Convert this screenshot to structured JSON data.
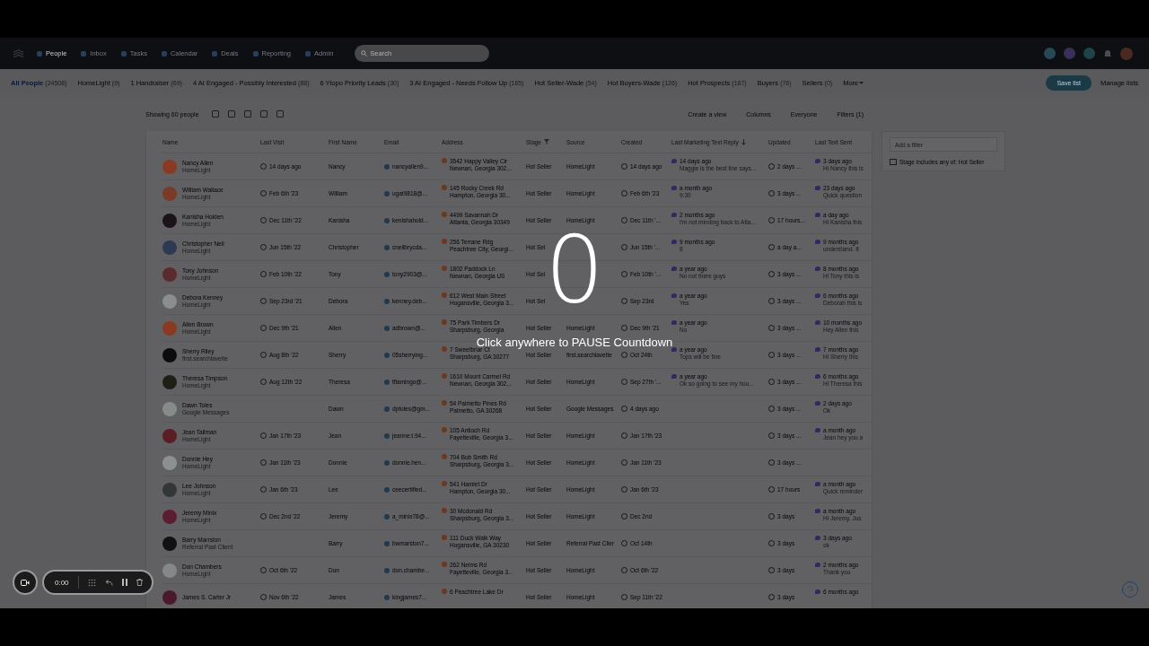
{
  "nav": {
    "items": [
      {
        "label": "People",
        "selected": true
      },
      {
        "label": "Inbox",
        "selected": false
      },
      {
        "label": "Tasks",
        "selected": false
      },
      {
        "label": "Calendar",
        "selected": false
      },
      {
        "label": "Deals",
        "selected": false
      },
      {
        "label": "Reporting",
        "selected": false
      },
      {
        "label": "Admin",
        "selected": false
      }
    ],
    "search": {
      "placeholder": "Search"
    }
  },
  "lists": {
    "tabs": [
      {
        "label": "All People",
        "count": "(24508)",
        "selected": true
      },
      {
        "label": "HomeLight",
        "count": "(9)",
        "selected": false
      },
      {
        "label": "1 Handraiser",
        "count": "(69)",
        "selected": false
      },
      {
        "label": "4 AI Engaged - Possibly Interested",
        "count": "(88)",
        "selected": false
      },
      {
        "label": "6 Ylopo Priority Leads",
        "count": "(30)",
        "selected": false
      },
      {
        "label": "3 AI Engaged - Needs Follow Up",
        "count": "(165)",
        "selected": false
      },
      {
        "label": "Hot Seller-Wade",
        "count": "(54)",
        "selected": false
      },
      {
        "label": "Hot Buyers-Wade",
        "count": "(126)",
        "selected": false
      },
      {
        "label": "Hot Prospects",
        "count": "(187)",
        "selected": false
      },
      {
        "label": "Buyers",
        "count": "(76)",
        "selected": false
      },
      {
        "label": "Sellers",
        "count": "(0)",
        "selected": false
      }
    ],
    "more": "More",
    "save_button": "Save list",
    "manage_link": "Manage lists"
  },
  "toolbar": {
    "showing": "Showing 60 people",
    "view_button": "Create a view",
    "columns_button": "Columns",
    "owner_filter": "Everyone",
    "filters_button": "Filters (1)"
  },
  "table": {
    "columns": [
      {
        "label": "Name",
        "kind": "plain"
      },
      {
        "label": "Last Visit",
        "kind": "plain"
      },
      {
        "label": "First Name",
        "kind": "plain"
      },
      {
        "label": "Email",
        "kind": "plain"
      },
      {
        "label": "Address",
        "kind": "plain"
      },
      {
        "label": "Stage",
        "kind": "filtered"
      },
      {
        "label": "Source",
        "kind": "plain"
      },
      {
        "label": "Created",
        "kind": "plain"
      },
      {
        "label": "Last Marketing Text Reply",
        "kind": "sorted"
      },
      {
        "label": "Updated",
        "kind": "plain"
      },
      {
        "label": "Last Text Sent",
        "kind": "plain"
      }
    ],
    "rows": [
      {
        "name": "Nancy Allen",
        "sub": "HomeLight",
        "color": "#8a3a22",
        "visit": "14 days ago",
        "first": "Nancy",
        "email": "nancyallen9...",
        "addr1": "3542 Happy Valley Cir",
        "addr2": "Newnan, Georgia 302...",
        "stage": "Hot Seller",
        "source": "HomeLight",
        "created": "14 days ago",
        "reply_time": "14 days ago",
        "reply_text": "Maggie is the best line says...",
        "updated": "2 days ...",
        "sent_time": "3 days ago",
        "sent_text": "Hi Nancy this is"
      },
      {
        "name": "William Wallace",
        "sub": "HomeLight",
        "color": "#7a3a28",
        "visit": "Feb 6th '23",
        "first": "William",
        "email": "ugat9818@...",
        "addr1": "145 Rocky Creek Rd",
        "addr2": "Hampton, Georgia 30...",
        "stage": "Hot Seller",
        "source": "HomeLight",
        "created": "Feb 6th '23",
        "reply_time": "a month ago",
        "reply_text": "9:30",
        "updated": "3 days ...",
        "sent_time": "23 days ago",
        "sent_text": "Quick question"
      },
      {
        "name": "Kanisha Holden",
        "sub": "HomeLight",
        "color": "#1a1416",
        "visit": "Dec 11th '22",
        "first": "Kanisha",
        "email": "kenishahold...",
        "addr1": "4499 Savannah Dr",
        "addr2": "Atlanta, Georgia 30349",
        "stage": "Hot Seller",
        "source": "HomeLight",
        "created": "Dec 11th '...",
        "reply_time": "2 months ago",
        "reply_text": "I'm not minding back to Atla...",
        "updated": "17 hours...",
        "sent_time": "a day ago",
        "sent_text": "Hi Kanisha this"
      },
      {
        "name": "Christopher Neil",
        "sub": "HomeLight",
        "color": "#2e3a52",
        "visit": "Jun 15th '22",
        "first": "Christopher",
        "email": "cneilbrycda...",
        "addr1": "256 Terrane Rdg",
        "addr2": "Peachtree City, Georgi...",
        "stage": "Hot Sel",
        "created": "Jun 15th '...",
        "reply_time": "9 months ago",
        "reply_text": "8",
        "updated": "a day a...",
        "sent_time": "9 months ago",
        "sent_text": "understand. It"
      },
      {
        "name": "Tony Johnson",
        "sub": "HomeLight",
        "color": "#5a2a2c",
        "visit": "Feb 10th '22",
        "first": "Tony",
        "email": "tony2903@...",
        "addr1": "1802 Paddock Ln",
        "addr2": "Newnan, Georgia US",
        "stage": "Hot Sel",
        "created": "Feb 10th '...",
        "reply_time": "a year ago",
        "reply_text": "No not there guys",
        "updated": "3 days ...",
        "sent_time": "8 months ago",
        "sent_text": "Hi Tony this is"
      },
      {
        "name": "Debora Kenney",
        "sub": "HomeLight",
        "color": "#8a8e8c",
        "visit": "Sep 23rd '21",
        "first": "Debora",
        "email": "kenney.deb...",
        "addr1": "612 West Main Street",
        "addr2": "Hogansville, Georgia 3...",
        "stage": "Hot Sel",
        "created": "Sep 23rd",
        "reply_time": "a year ago",
        "reply_text": "Yes",
        "updated": "3 days ...",
        "sent_time": "6 months ago",
        "sent_text": "Deborah this is"
      },
      {
        "name": "Allen Brown",
        "sub": "HomeLight",
        "color": "#8a3a20",
        "visit": "Dec 9th '21",
        "first": "Allen",
        "email": "adbrown@...",
        "addr1": "75 Park Timbers Dr",
        "addr2": "Sharpsburg, Georgia",
        "stage": "Hot Seller",
        "source": "HomeLight",
        "created": "Dec 9th '21",
        "reply_time": "a year ago",
        "reply_text": "No",
        "updated": "3 days ...",
        "sent_time": "10 months ago",
        "sent_text": "Hey Allen this"
      },
      {
        "name": "Sherry Riley",
        "sub": "first.searchlavette",
        "color": "#0c0c0e",
        "visit": "Aug 8th '22",
        "first": "Sherry",
        "email": "05sherrying...",
        "addr1": "7 Sweetbriar Ct",
        "addr2": "Sharpsburg, GA 30277",
        "stage": "Hot Seller",
        "source": "first.searchlavette",
        "created": "Oct 24th",
        "reply_time": "a year ago",
        "reply_text": "Tops will be fine",
        "updated": "3 days ...",
        "sent_time": "7 months ago",
        "sent_text": "Hi Sherry this"
      },
      {
        "name": "Theresa Timpson",
        "sub": "HomeLight",
        "color": "#1e2018",
        "visit": "Aug 12th '22",
        "first": "Theresa",
        "email": "tflamingo@...",
        "addr1": "1610 Mount Carmel Rd",
        "addr2": "Newnan, Georgia 302...",
        "stage": "Hot Seller",
        "source": "HomeLight",
        "created": "Sep 27th '...",
        "reply_time": "a year ago",
        "reply_text": "Ok so going to see my hou...",
        "updated": "3 days ...",
        "sent_time": "6 months ago",
        "sent_text": "Hi Theresa this"
      },
      {
        "name": "Dawn Toles",
        "sub": "Google Messages",
        "color": "#868a88",
        "first": "Dawn",
        "email": "dptoles@gm...",
        "addr1": "54 Palmetto Pines Rd",
        "addr2": "Palmetto, GA 30268",
        "stage": "Hot Seller",
        "source": "Google Messages",
        "created": "4 days ago",
        "updated": "3 days ...",
        "sent_time": "2 days ago",
        "sent_text": "Ok"
      },
      {
        "name": "Jean Tallman",
        "sub": "HomeLight",
        "color": "#5a1e24",
        "visit": "Jan 17th '23",
        "first": "Jean",
        "email": "jeanne.t.94...",
        "addr1": "105 Antioch Rd",
        "addr2": "Fayetteville, Georgia 3...",
        "stage": "Hot Seller",
        "source": "HomeLight",
        "created": "Jan 17th '23",
        "updated": "3 days ...",
        "sent_time": "a month ago",
        "sent_text": "Jean hey you a"
      },
      {
        "name": "Donnie Hey",
        "sub": "HomeLight",
        "color": "#8c908e",
        "visit": "Jan 11th '23",
        "first": "Donnie",
        "email": "donnie.hen...",
        "addr1": "704 Bob Smith Rd",
        "addr2": "Sharpsburg, Georgia 3...",
        "stage": "Hot Seller",
        "source": "HomeLight",
        "created": "Jan 11th '23",
        "updated": "3 days ..."
      },
      {
        "name": "Lee Johnson",
        "sub": "HomeLight",
        "color": "#323634",
        "visit": "Jan 6th '23",
        "first": "Lee",
        "email": "ceecertified...",
        "addr1": "541 Hamlet Dr",
        "addr2": "Hampton, Georgia 30...",
        "stage": "Hot Seller",
        "source": "HomeLight",
        "created": "Jan 6th '23",
        "updated": "17 hours",
        "sent_time": "a month ago",
        "sent_text": "Quick reminder"
      },
      {
        "name": "Jeremy Minix",
        "sub": "HomeLight",
        "color": "#5a1e30",
        "visit": "Dec 2nd '22",
        "first": "Jeremy",
        "email": "a_minix78@...",
        "addr1": "30 Mcdonald Rd",
        "addr2": "Sharpsburg, Georgia 3...",
        "stage": "Hot Seller",
        "source": "HomeLight",
        "created": "Dec 2nd",
        "updated": "3 days",
        "sent_time": "a month ago",
        "sent_text": "Hi Jeremy, Jus"
      },
      {
        "name": "Barry Marrston",
        "sub": "Referral Past Client",
        "color": "#101212",
        "first": "Barry",
        "email": "bwmarston7...",
        "addr1": "111 Duck Walk Way",
        "addr2": "Hogansville, GA 30230",
        "stage": "Hot Seller",
        "source": "Referral Past Clier",
        "created": "Oct 14th",
        "updated": "3 days",
        "sent_time": "3 days ago",
        "sent_text": "ok"
      },
      {
        "name": "Don Chambers",
        "sub": "HomeLight",
        "color": "#848886",
        "visit": "Oct 6th '22",
        "first": "Don",
        "email": "don.chambe...",
        "addr1": "262 Nelms Rd",
        "addr2": "Fayetteville, Georgia 3...",
        "stage": "Hot Seller",
        "source": "HomeLight",
        "created": "Oct 6th '22",
        "updated": "3 days",
        "sent_time": "2 months ago",
        "sent_text": "Thank you"
      },
      {
        "name": "James S. Carter Jr",
        "color": "#4a1a2c",
        "visit": "Nov 6th '22",
        "first": "James",
        "email": "kingjames7...",
        "addr1": "6 Peachtree Lake Dr",
        "stage": "Hot Seller",
        "source": "HomeLight",
        "created": "Sep 11th '22",
        "updated": "3 days",
        "sent_time": "6 months ago"
      }
    ]
  },
  "filter_panel": {
    "placeholder": "Add a filter",
    "filters": [
      "Stage includes any of: Hot Seller"
    ]
  },
  "countdown": {
    "number": "0",
    "caption": "Click anywhere to PAUSE Countdown"
  },
  "recorder": {
    "time": "0:00"
  }
}
